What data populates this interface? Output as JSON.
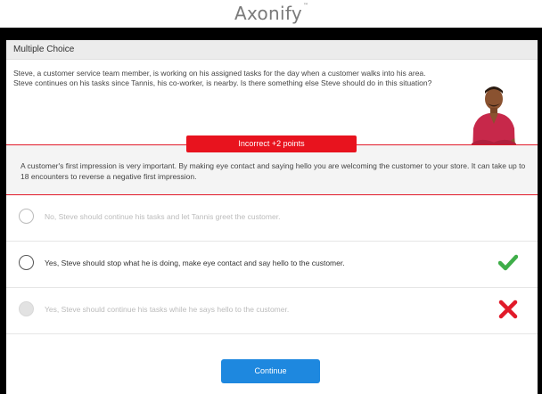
{
  "app": {
    "logo_text": "Axonify",
    "logo_tm": "™"
  },
  "card": {
    "title": "Multiple Choice"
  },
  "question": {
    "line1": "Steve, a customer service team member, is working on his assigned tasks for the day when a customer walks into his area.",
    "line2": "Steve continues on his tasks since Tannis, his co-worker, is nearby. Is there something else Steve should do in this situation?"
  },
  "feedback": {
    "badge": "Incorrect +2 points",
    "text": "A customer's first impression is very important. By making eye contact and saying hello you are welcoming the customer to your store. It can take up to 18 encounters to reverse a negative first impression."
  },
  "options": [
    {
      "label": "No, Steve should continue his tasks and let Tannis greet the customer.",
      "state": "disabled",
      "mark": ""
    },
    {
      "label": "Yes, Steve should stop what he is doing, make eye contact and say hello to the customer.",
      "state": "correct",
      "mark": "check-icon"
    },
    {
      "label": "Yes, Steve should continue his tasks while he says hello to the customer.",
      "state": "selected-incorrect",
      "mark": "x-icon"
    }
  ],
  "colors": {
    "accent_red": "#e8131e",
    "button_blue": "#1e88df",
    "check_green": "#3fae49"
  },
  "buttons": {
    "continue_label": "Continue"
  }
}
